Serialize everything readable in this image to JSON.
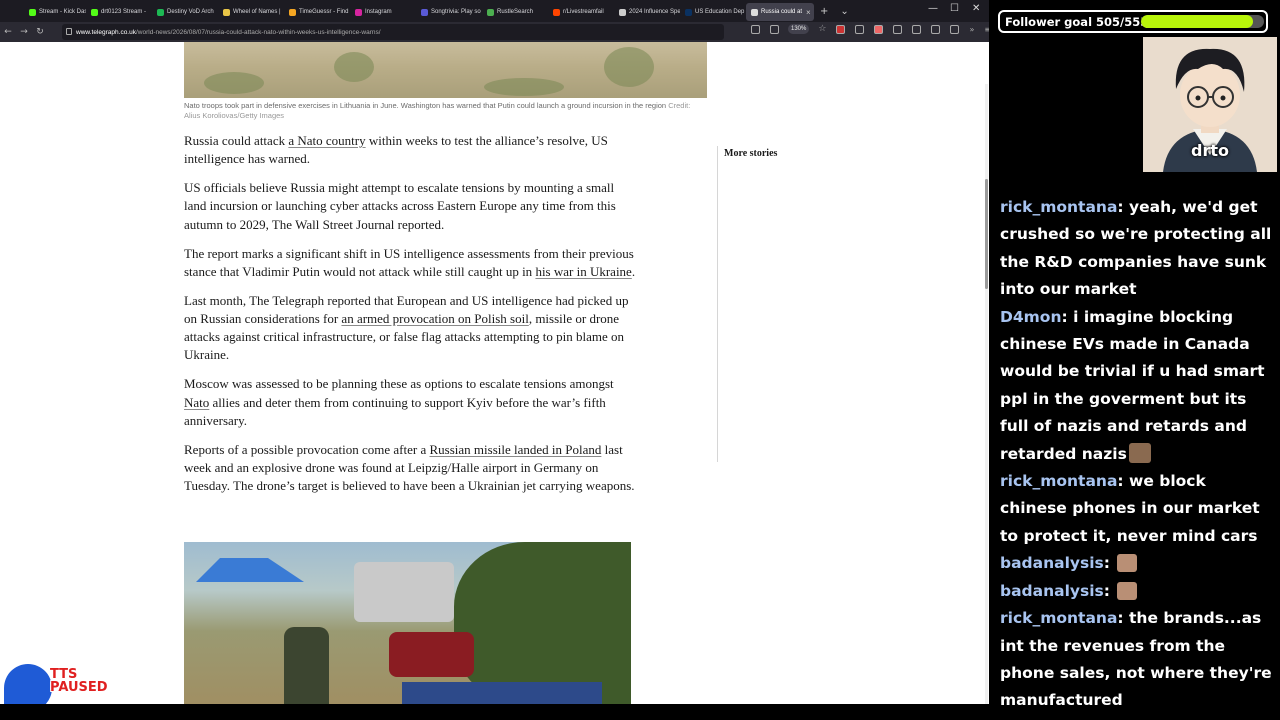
{
  "browser": {
    "tabs": [
      {
        "label": "Stream - Kick Dash",
        "fav": "#53fc18"
      },
      {
        "label": "drt0123 Stream - ",
        "fav": "#53fc18"
      },
      {
        "label": "Destiny VoD Arch",
        "fav": "#1db954"
      },
      {
        "label": "Wheel of Names |",
        "fav": "#e8c547"
      },
      {
        "label": "TimeGuessr - Find",
        "fav": "#f5a623"
      },
      {
        "label": "Instagram",
        "fav": "#d6249f"
      },
      {
        "label": "Songtrivia: Play so",
        "fav": "#5a5ad6"
      },
      {
        "label": "RustleSearch",
        "fav": "#4caf50"
      },
      {
        "label": "r/Livestreamfail",
        "fav": "#ff4500"
      },
      {
        "label": "2024 Influence Spendi",
        "fav": "#cccccc"
      },
      {
        "label": "US Education Dep",
        "fav": "#0a3161"
      },
      {
        "label": "Russia could at",
        "fav": "#dddddd",
        "active": true
      }
    ],
    "new_tab": "+",
    "tab_list": "⌄",
    "win_min": "—",
    "win_max": "☐",
    "win_close": "✕",
    "url_host": "www.telegraph.co.uk",
    "url_path": "/world-news/2026/08/07/russia-could-attack-nato-within-weeks-us-intelligence-warns/",
    "zoom": "130%"
  },
  "article": {
    "caption": "Nato troops took part in defensive exercises in Lithuania in June. Washington has warned that Putin could launch a ground incursion in the region",
    "caption_credit": "Credit: Alius Koroliovas/Getty Images",
    "p1_a": "Russia could attack ",
    "p1_link": "a Nato country",
    "p1_b": " within weeks to test the alliance’s resolve, US intelligence has warned.",
    "p2": "US officials believe Russia might attempt to escalate tensions by mounting a small land incursion or launching cyber attacks across Eastern Europe any time from this autumn to 2029, The Wall Street Journal reported.",
    "p3_a": "The report marks a significant shift in US intelligence assessments from their previous stance that Vladimir Putin would not attack while still caught up in ",
    "p3_link": "his war in Ukraine",
    "p3_b": ".",
    "p4_a": "Last month, The Telegraph reported that European and US intelligence had picked up on Russian considerations for ",
    "p4_link": "an armed provocation on Polish soil",
    "p4_b": ", missile or drone attacks against critical infrastructure, or false flag attacks attempting to pin blame on Ukraine.",
    "p5_a": "Moscow was assessed to be planning these as options to escalate tensions amongst ",
    "p5_link": "Nato",
    "p5_b": " allies and deter them from continuing to support Kyiv before the war’s fifth anniversary.",
    "p6_a": "Reports of a possible provocation come after a ",
    "p6_link": "Russian missile landed in Poland",
    "p6_b": " last week and an explosive drone was found at Leipzig/Halle airport in Germany on Tuesday. The drone’s target is believed to have been a Ukrainian jet carrying weapons.",
    "sidebar_heading": "More stories"
  },
  "tts": {
    "line1": "TTS",
    "line2": "PAUSED"
  },
  "stream": {
    "goal_label": "Follower goal 505/555",
    "goal_progress": 0.91,
    "goal_color": "#b8f50a",
    "cam_label": "drto",
    "chat": [
      {
        "user": "rick_montana",
        "text": "yeah, we'd get crushed so we're protecting all the R&D companies have sunk into our market",
        "emote": false
      },
      {
        "user": "D4mon",
        "text": "i imagine blocking chinese EVs made in Canada would be trivial if u had smart ppl in the goverment but its full of nazis and retards and retarded nazis",
        "emote": true
      },
      {
        "user": "rick_montana",
        "text": "we block chinese phones in our market to protect it, never mind cars",
        "emote": false
      },
      {
        "user": "badanalysis",
        "text": "",
        "emote": true
      },
      {
        "user": "badanalysis",
        "text": "",
        "emote": true
      },
      {
        "user": "rick_montana",
        "text": "the brands...as int the revenues from the phone sales, not where they're manufactured",
        "emote": false
      }
    ]
  }
}
